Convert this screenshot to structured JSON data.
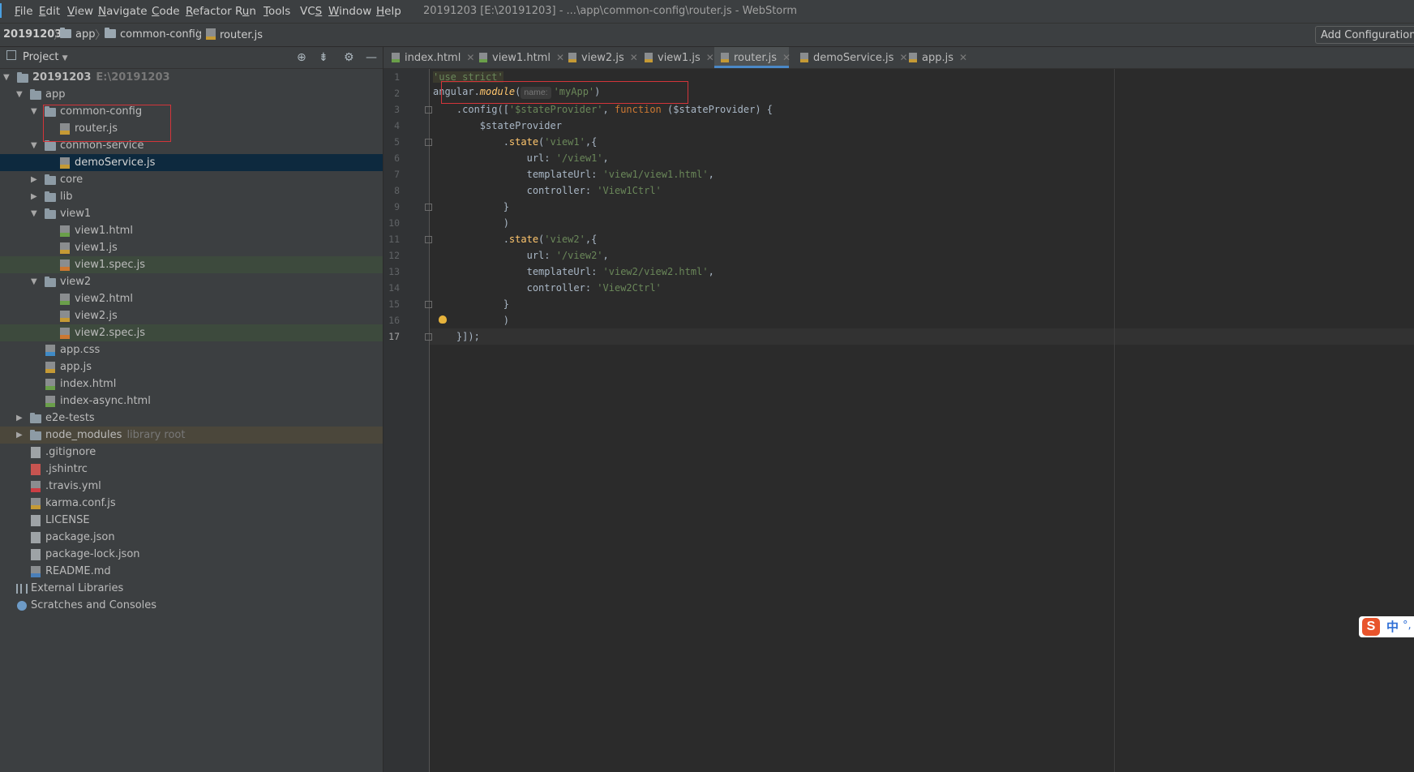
{
  "menubar": {
    "items": [
      {
        "pre": "",
        "u": "F",
        "post": "ile"
      },
      {
        "pre": "",
        "u": "E",
        "post": "dit"
      },
      {
        "pre": "",
        "u": "V",
        "post": "iew"
      },
      {
        "pre": "",
        "u": "N",
        "post": "avigate"
      },
      {
        "pre": "",
        "u": "C",
        "post": "ode"
      },
      {
        "pre": "",
        "u": "R",
        "post": "efactor"
      },
      {
        "pre": "R",
        "u": "u",
        "post": "n"
      },
      {
        "pre": "",
        "u": "T",
        "post": "ools"
      },
      {
        "pre": "VC",
        "u": "S",
        "post": ""
      },
      {
        "pre": "",
        "u": "W",
        "post": "indow"
      },
      {
        "pre": "",
        "u": "H",
        "post": "elp"
      }
    ],
    "window_title": "20191203 [E:\\20191203] - ...\\app\\common-config\\router.js - WebStorm"
  },
  "navbar": {
    "crumbs": [
      "20191203",
      "app",
      "common-config",
      "router.js"
    ],
    "add_config": "Add Configuration..."
  },
  "project_panel": {
    "title": "Project",
    "tree": [
      {
        "label": "20191203",
        "hint": "E:\\20191203",
        "bold": true
      },
      {
        "label": "app"
      },
      {
        "label": "common-config"
      },
      {
        "label": "router.js"
      },
      {
        "label": "conmon-service"
      },
      {
        "label": "demoService.js"
      },
      {
        "label": "core"
      },
      {
        "label": "lib"
      },
      {
        "label": "view1"
      },
      {
        "label": "view1.html"
      },
      {
        "label": "view1.js"
      },
      {
        "label": "view1.spec.js"
      },
      {
        "label": "view2"
      },
      {
        "label": "view2.html"
      },
      {
        "label": "view2.js"
      },
      {
        "label": "view2.spec.js"
      },
      {
        "label": "app.css"
      },
      {
        "label": "app.js"
      },
      {
        "label": "index.html"
      },
      {
        "label": "index-async.html"
      },
      {
        "label": "e2e-tests"
      },
      {
        "label": "node_modules",
        "hint": "library root"
      },
      {
        "label": ".gitignore"
      },
      {
        "label": ".jshintrc"
      },
      {
        "label": ".travis.yml"
      },
      {
        "label": "karma.conf.js"
      },
      {
        "label": "LICENSE"
      },
      {
        "label": "package.json"
      },
      {
        "label": "package-lock.json"
      },
      {
        "label": "README.md"
      },
      {
        "label": "External Libraries"
      },
      {
        "label": "Scratches and Consoles"
      }
    ]
  },
  "tabs": [
    {
      "label": "index.html",
      "type": "html"
    },
    {
      "label": "view1.html",
      "type": "html"
    },
    {
      "label": "view2.js",
      "type": "js"
    },
    {
      "label": "view1.js",
      "type": "js"
    },
    {
      "label": "router.js",
      "type": "js",
      "active": true
    },
    {
      "label": "demoService.js",
      "type": "js"
    },
    {
      "label": "app.js",
      "type": "js"
    }
  ],
  "editor": {
    "line_numbers": [
      "1",
      "2",
      "3",
      "4",
      "5",
      "6",
      "7",
      "8",
      "9",
      "10",
      "11",
      "12",
      "13",
      "14",
      "15",
      "16",
      "17"
    ],
    "current_line": "17",
    "param_hint": "name:",
    "code": {
      "l1": "'use strict'",
      "l2_a": "angular.",
      "l2_fn": "module",
      "l2_b": "(",
      "l2_s": "'myApp'",
      "l2_c": ")",
      "l3_a": "    .config([",
      "l3_s": "'$stateProvider'",
      "l3_b": ", ",
      "l3_k": "function",
      "l3_c": " ($stateProvider) {",
      "l4": "        $stateProvider",
      "l5_a": "            .",
      "l5_m": "state",
      "l5_b": "(",
      "l5_s": "'view1'",
      "l5_c": ",{",
      "l6_a": "                url: ",
      "l6_s": "'/view1'",
      "l6_c": ",",
      "l7_a": "                templateUrl: ",
      "l7_s": "'view1/view1.html'",
      "l7_c": ",",
      "l8_a": "                controller: ",
      "l8_s": "'View1Ctrl'",
      "l9": "            }",
      "l10": "            )",
      "l11_a": "            .",
      "l11_m": "state",
      "l11_b": "(",
      "l11_s": "'view2'",
      "l11_c": ",{",
      "l12_a": "                url: ",
      "l12_s": "'/view2'",
      "l12_c": ",",
      "l13_a": "                templateUrl: ",
      "l13_s": "'view2/view2.html'",
      "l13_c": ",",
      "l14_a": "                controller: ",
      "l14_s": "'View2Ctrl'",
      "l15": "            }",
      "l16": "            )",
      "l17": "    }]);"
    }
  },
  "ime": {
    "logo": "S",
    "zh": "中",
    "dot": "°,"
  },
  "colors": {
    "accent": "#4a88c7",
    "highlight_box": "#d3353a",
    "selection": "#0d293e"
  }
}
